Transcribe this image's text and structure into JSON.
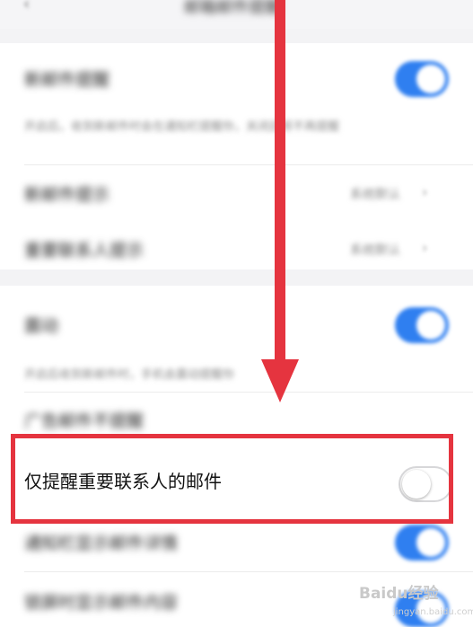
{
  "header": {
    "back_icon": "chevron-left",
    "title": "邮箱邮件提醒"
  },
  "section1": {
    "row_mail_notify": {
      "label": "新邮件提醒",
      "toggle": "on"
    },
    "mail_notify_desc": "开启后，收到新邮件时会在通知栏提醒你，关闭后将不再提醒",
    "row_new_mail_sound": {
      "label": "新邮件提示",
      "value": "系统默认"
    },
    "row_important_sound": {
      "label": "重要联系人提示",
      "value": "系统默认"
    }
  },
  "section2": {
    "row_vibrate": {
      "label": "震动",
      "toggle": "on"
    },
    "vibrate_desc": "开启后收到新邮件时，手机会震动提醒你",
    "row_ad_notify": {
      "label": "广告邮件不提醒"
    },
    "row_important_only": {
      "label": "仅提醒重要联系人的邮件",
      "toggle": "off"
    },
    "row_show_detail": {
      "label": "通知栏显示邮件详情",
      "toggle": "on"
    },
    "row_lock_screen": {
      "label": "锁屏时显示邮件内容",
      "toggle": "on"
    }
  },
  "annotation": {
    "color": "#e5343f"
  },
  "watermark": {
    "text": "Baidu经验",
    "url": "jingyan.baidu.com"
  },
  "colors": {
    "toggle_on": "#2f7ff0",
    "background": "#f3f3f5",
    "card": "#ffffff"
  }
}
